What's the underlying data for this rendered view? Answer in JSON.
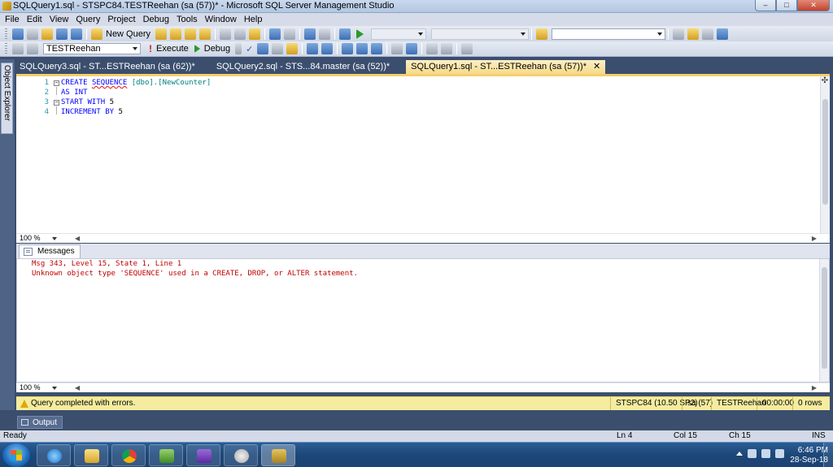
{
  "window": {
    "title": "SQLQuery1.sql - STSPC84.TESTReehan (sa (57))* - Microsoft SQL Server Management Studio",
    "min": "–",
    "max": "□",
    "close": "✕"
  },
  "menu": [
    "File",
    "Edit",
    "View",
    "Query",
    "Project",
    "Debug",
    "Tools",
    "Window",
    "Help"
  ],
  "toolbar1": {
    "new_query": "New Query"
  },
  "toolbar2": {
    "database": "TESTReehan",
    "execute": "Execute",
    "debug": "Debug"
  },
  "side": {
    "object_explorer": "Object Explorer"
  },
  "tabs": [
    {
      "label": "SQLQuery3.sql - ST...ESTReehan (sa (62))*"
    },
    {
      "label": "SQLQuery2.sql - STS...84.master (sa (52))*"
    },
    {
      "label": "SQLQuery1.sql - ST...ESTReehan (sa (57))*"
    }
  ],
  "tab_close": "✕",
  "editor": {
    "lines": [
      {
        "num": "1",
        "kw1": "CREATE",
        "kw2": "SEQUENCE",
        "ident": "[dbo].[NewCounter]"
      },
      {
        "num": "2",
        "kw1": "AS",
        "kw2": "INT"
      },
      {
        "num": "3",
        "kw1": "START",
        "kw2": "WITH",
        "val": "5"
      },
      {
        "num": "4",
        "kw1": "INCREMENT",
        "kw2": "BY",
        "val": "5"
      }
    ],
    "zoom": "100 %"
  },
  "results": {
    "tab": "Messages",
    "lines": [
      "Msg 343, Level 15, State 1, Line 1",
      "Unknown object type 'SEQUENCE' used in a CREATE, DROP, or ALTER statement."
    ],
    "zoom": "100 %"
  },
  "query_status": {
    "message": "Query completed with errors.",
    "server": "STSPC84 (10.50 SP2)",
    "user": "sa (57)",
    "database": "TESTReehan",
    "time": "00:00:00",
    "rows": "0 rows"
  },
  "output": {
    "label": "Output"
  },
  "statusbar": {
    "ready": "Ready",
    "ln": "Ln 4",
    "col": "Col 15",
    "ch": "Ch 15",
    "ins": "INS"
  },
  "taskbar": {
    "time": "6:46 PM",
    "date": "28-Sep-18"
  },
  "colors": {
    "accent_tab": "#f6d98a",
    "status_yellow": "#f5ec9f",
    "error_red": "#c00000",
    "keyword_blue": "#0000ff"
  }
}
